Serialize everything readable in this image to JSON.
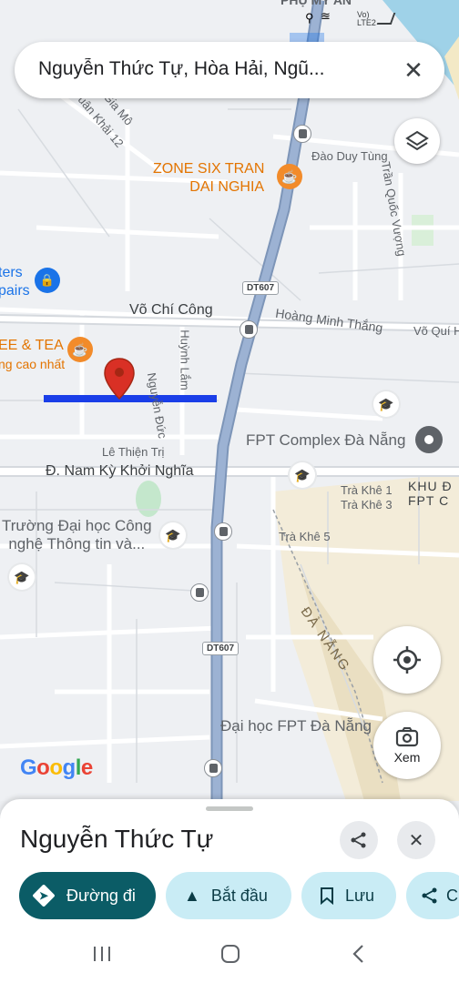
{
  "status_bar": {
    "location_hint": "PHỤ MỸ AN",
    "network": "Vo) LTE2"
  },
  "search": {
    "value": "Nguyễn Thức Tự, Hòa Hải, Ngũ..."
  },
  "map": {
    "pois": {
      "zone_six": [
        "ZONE SIX TRAN",
        "DAI NGHIA"
      ],
      "coffee_tea": [
        "EE & TEA",
        "ng cao nhất"
      ],
      "masters": [
        "ters",
        "pairs"
      ],
      "fpt_complex": "FPT Complex Đà Nẵng",
      "university_cntt": [
        "Trường Đại học Công",
        "nghệ Thông tin và..."
      ],
      "fpt_university": "Đại học FPT Đà Nẵng",
      "khu": [
        "KHU Đ",
        "FPT C"
      ]
    },
    "streets": {
      "vo_chi_cong": "Võ Chí Công",
      "hoang_minh_thang": "Hoàng Minh Thắng",
      "vo_qui": "Võ Quí H",
      "dao_duy_tung": "Đào Duy Tùng",
      "tran_quoc_vuong": "Trần Quốc Vượng",
      "huynh_lam": "Huỳnh Lắm",
      "nguyen_duc": "Nguyễn Đức",
      "le_thien_tri": "Lê Thiện Trị",
      "nam_ky": "Đ. Nam Kỳ Khởi Nghĩa",
      "tra_khe_1": "Trà Khê 1",
      "tra_khe_3": "Trà Khê 3",
      "tra_khe_5": "Trà Khê 5",
      "gia_mo": "g Gia Mô",
      "khai_12": "uân Khải 12",
      "da_nang": "ĐÀ NẴNG"
    },
    "shields": {
      "top": "DT607",
      "bottom": "DT607"
    },
    "logo": "Google"
  },
  "buttons": {
    "camera_label": "Xem"
  },
  "sheet": {
    "title": "Nguyễn Thức Tự",
    "chips": [
      {
        "label": "Đường đi"
      },
      {
        "label": "Bắt đầu"
      },
      {
        "label": "Lưu"
      },
      {
        "label": "C"
      }
    ]
  },
  "colors": {
    "primary": "#0b5c66",
    "chip_bg": "#c9ecf5",
    "highlight": "#1a3ee8",
    "pin": "#d93025",
    "road": "#8ea6c9"
  }
}
